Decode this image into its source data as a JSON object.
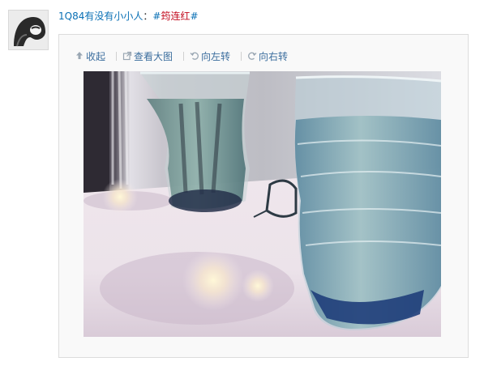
{
  "post": {
    "user": "1Q84有没有小小人",
    "colon": "：",
    "hash_open": "#",
    "topic": "筠连红",
    "hash_close": "#"
  },
  "toolbar": {
    "collapse_label": "收起",
    "view_large_label": "查看大图",
    "rotate_left_label": "向左转",
    "rotate_right_label": "向右转"
  },
  "icons": {
    "avatar": "user-avatar-icon",
    "collapse": "arrow-up-icon",
    "view_large": "external-link-icon",
    "rotate_left": "rotate-left-icon",
    "rotate_right": "rotate-right-icon"
  },
  "colors": {
    "link": "#0a70b5",
    "topic": "#c20b1e",
    "toolbar_text": "#3c6e9e"
  }
}
